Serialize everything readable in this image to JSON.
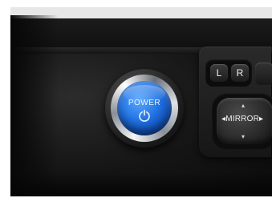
{
  "photo": {
    "power_button": {
      "label": "POWER",
      "icon": "power-icon",
      "color_face": "#1f6fe0",
      "color_chrome": "#dfe3e8"
    },
    "mirror_controls": {
      "left_label": "L",
      "right_label": "R",
      "mirror_label": "MIRROR",
      "left_arrow": "◂",
      "right_arrow": "▸",
      "up_arrow": "▴",
      "down_arrow": "▾"
    },
    "colors": {
      "background": "#ffffff",
      "dashboard": "#151515"
    }
  }
}
